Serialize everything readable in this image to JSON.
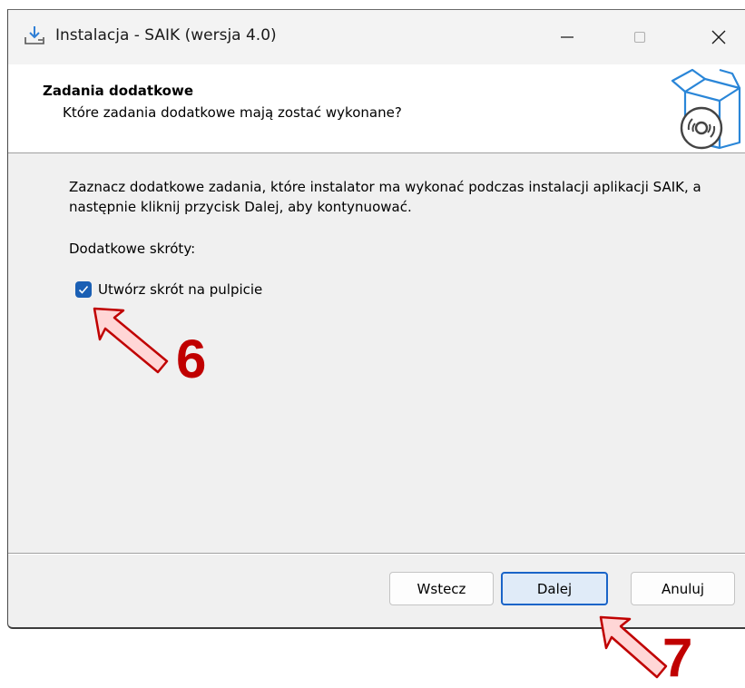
{
  "window": {
    "title": "Instalacja - SAIK (wersja 4.0)"
  },
  "titlebar": {
    "icons": [
      "installer-download-icon",
      "minimize-icon",
      "maximize-icon",
      "close-icon"
    ]
  },
  "header": {
    "title": "Zadania dodatkowe",
    "subtitle": "Które zadania dodatkowe mają zostać wykonane?",
    "icon": "software-box-cd-icon"
  },
  "content": {
    "description": "Zaznacz dodatkowe zadania, które instalator ma wykonać podczas instalacji aplikacji SAIK, a następnie kliknij przycisk Dalej, aby kontynuować.",
    "shortcuts_label": "Dodatkowe skróty:",
    "checkbox": {
      "label": "Utwórz skrót na pulpicie",
      "checked": true
    }
  },
  "buttons": {
    "back": "Wstecz",
    "next": "Dalej",
    "cancel": "Anuluj"
  },
  "annotations": {
    "step6": "6",
    "step7": "7",
    "color": "#c00000"
  },
  "colors": {
    "accent": "#1a5fb4",
    "default_button_border": "#1a64c8"
  }
}
